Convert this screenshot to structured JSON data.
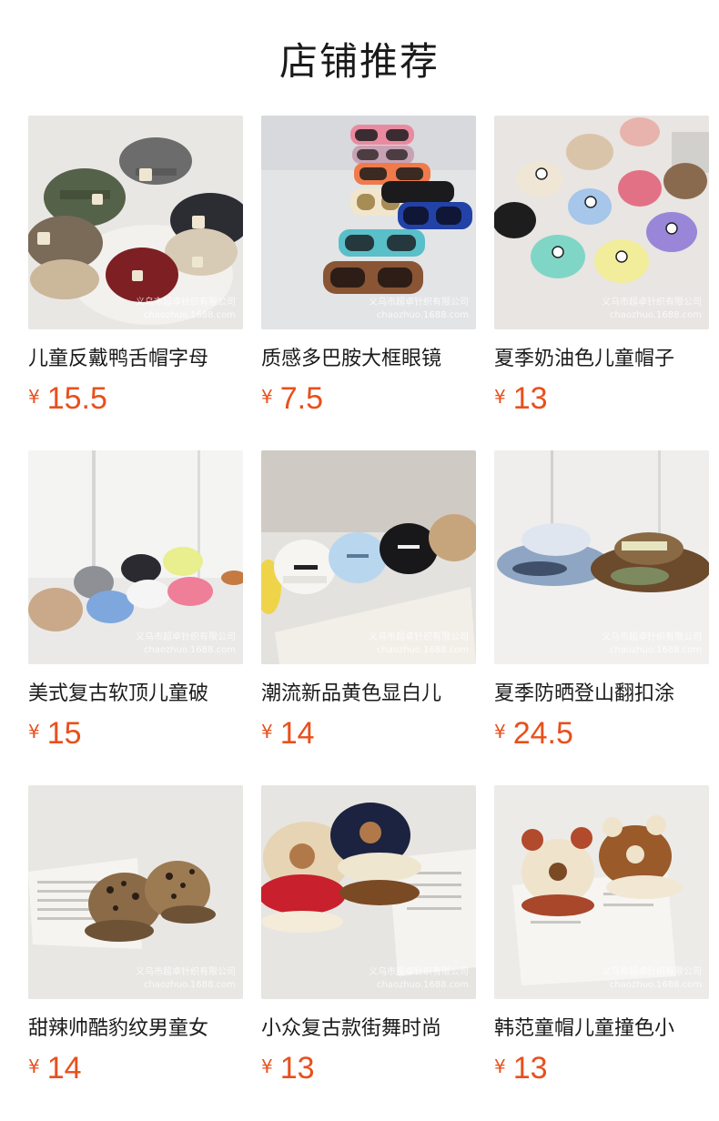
{
  "page": {
    "title": "店铺推荐"
  },
  "watermark": {
    "line1": "义乌市超卓针织有限公司",
    "line2": "chaozhuo.1688.com"
  },
  "currency_symbol": "¥",
  "products": [
    {
      "title": "儿童反戴鸭舌帽字母",
      "price": "15.5",
      "image": "w-logo-caps-pile"
    },
    {
      "title": "质感多巴胺大框眼镜",
      "price": "7.5",
      "image": "colorful-sunglasses"
    },
    {
      "title": "夏季奶油色儿童帽子",
      "price": "13",
      "image": "pastel-panda-caps"
    },
    {
      "title": "美式复古软顶儿童破",
      "price": "15",
      "image": "distressed-letter-caps"
    },
    {
      "title": "潮流新品黄色显白儿",
      "price": "14",
      "image": "script-logo-caps"
    },
    {
      "title": "夏季防晒登山翻扣涂",
      "price": "24.5",
      "image": "bucket-hats"
    },
    {
      "title": "甜辣帅酷豹纹男童女",
      "price": "14",
      "image": "leopard-caps"
    },
    {
      "title": "小众复古款街舞时尚",
      "price": "13",
      "image": "bear-snapback-caps"
    },
    {
      "title": "韩范童帽儿童撞色小",
      "price": "13",
      "image": "bear-ear-caps"
    }
  ]
}
